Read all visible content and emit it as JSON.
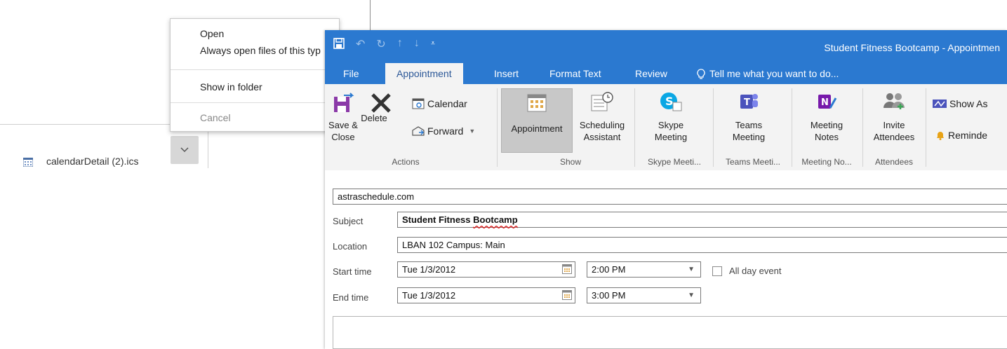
{
  "browser": {
    "download": {
      "file_name": "calendarDetail (2).ics"
    },
    "context_menu": {
      "items": [
        "Open",
        "Always open files of this typ",
        "Show in folder",
        "Cancel"
      ]
    }
  },
  "outlook": {
    "window_title": "Student Fitness Bootcamp - Appointmen",
    "tabs": [
      "File",
      "Appointment",
      "Insert",
      "Format Text",
      "Review"
    ],
    "tell_me": "Tell me what you want to do...",
    "ribbon": {
      "actions": {
        "save_close": "Save &\nClose",
        "delete": "Delete",
        "calendar": "Calendar",
        "forward": "Forward",
        "label": "Actions"
      },
      "show": {
        "appointment": "Appointment",
        "scheduling": "Scheduling\nAssistant",
        "label": "Show"
      },
      "skype": {
        "button": "Skype\nMeeting",
        "label": "Skype Meeti..."
      },
      "teams": {
        "button": "Teams\nMeeting",
        "label": "Teams Meeti..."
      },
      "notes": {
        "button": "Meeting\nNotes",
        "label": "Meeting No..."
      },
      "attendees": {
        "button": "Invite\nAttendees",
        "label": "Attendees"
      },
      "options": {
        "show_as": "Show As",
        "reminder": "Reminde"
      }
    },
    "form": {
      "organizer": "astraschedule.com",
      "subject_label": "Subject",
      "subject_value": "Student Fitness ",
      "subject_value_misspelled": "Bootcamp",
      "location_label": "Location",
      "location_value": "LBAN 102 Campus: Main",
      "start_label": "Start time",
      "start_date": "Tue 1/3/2012",
      "start_time": "2:00 PM",
      "end_label": "End time",
      "end_date": "Tue 1/3/2012",
      "end_time": "3:00 PM",
      "all_day_label": "All day event"
    }
  }
}
